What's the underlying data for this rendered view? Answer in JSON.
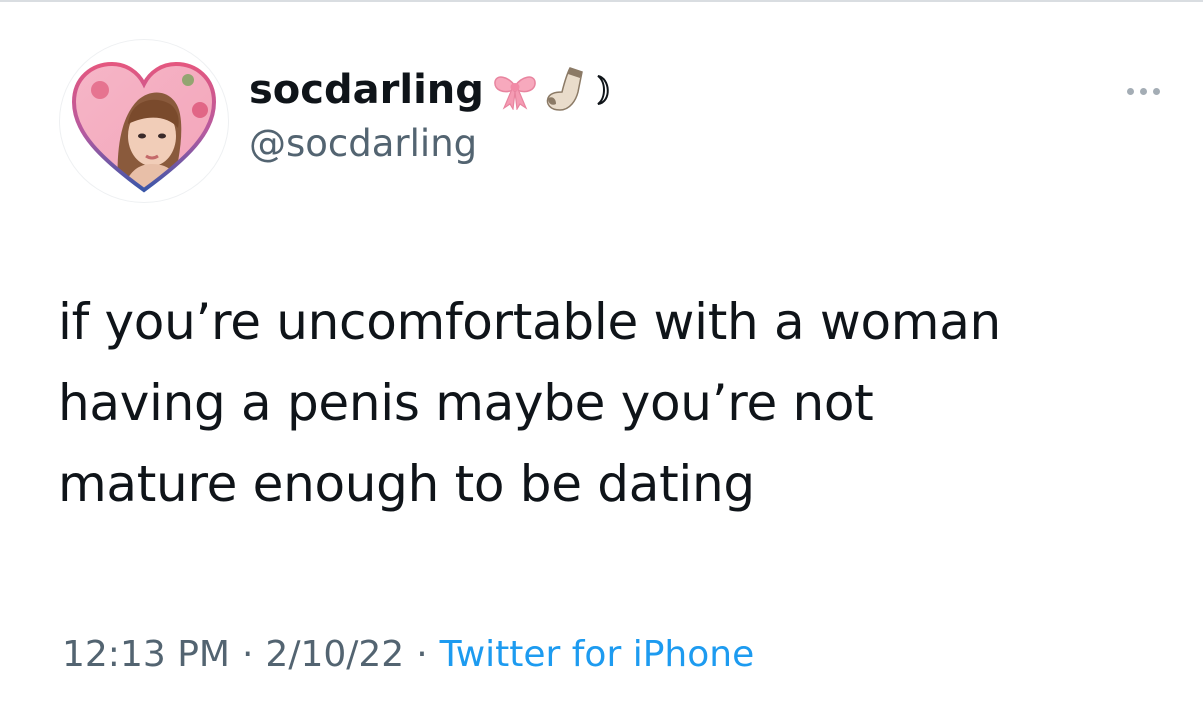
{
  "tweet": {
    "display_name": "socdarling",
    "handle": "@socdarling",
    "name_emojis": [
      "ribbon-emoji",
      "sock-emoji",
      "crescent-moon"
    ],
    "text_lines": [
      "if you’re uncomfortable with a woman",
      "having a penis maybe you’re not",
      "mature enough to be dating"
    ],
    "time": "12:13 PM",
    "date": "2/10/22",
    "separator": "·",
    "source": "Twitter for iPhone"
  },
  "colors": {
    "text": "#0f1419",
    "muted": "#536471",
    "link": "#1d9bf0",
    "heart_frame_top": "#e4577f",
    "heart_frame_bottom": "#3a56a8"
  },
  "icons": {
    "more": "more-horizontal-icon",
    "avatar": "heart-frame-avatar"
  }
}
